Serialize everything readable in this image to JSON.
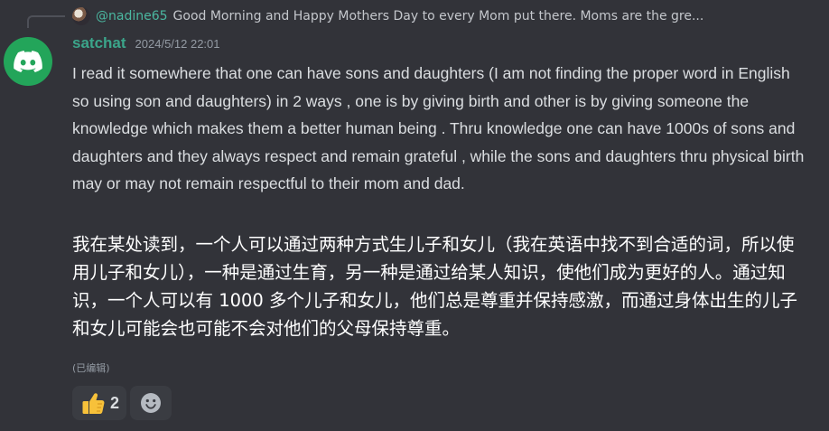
{
  "reply": {
    "author": "@nadine65",
    "text": "Good Morning and Happy Mothers Day to every Mom put there.  Moms are the gre..."
  },
  "message": {
    "author": "satchat",
    "timestamp": "2024/5/12 22:01",
    "content": "I read it somewhere that one can have sons and daughters (I am not finding the proper word in English so using son and daughters)  in 2 ways , one is by giving birth and other is by giving someone the knowledge which makes them a better human being . Thru knowledge one can have 1000s of sons and daughters and they always respect and remain grateful , while the sons and daughters thru physical birth  may or may not remain respectful to their mom and dad.",
    "translation": "我在某处读到，一个人可以通过两种方式生儿子和女儿（我在英语中找不到合适的词，所以使用儿子和女儿），一种是通过生育，另一种是通过给某人知识，使他们成为更好的人。通过知识，一个人可以有 1000 多个儿子和女儿，他们总是尊重并保持感激，而通过身体出生的儿子和女儿可能会也可能不会对他们的父母保持尊重。",
    "edited_label": "(已编辑)"
  },
  "reactions": [
    {
      "icon": "thumbs-up-icon",
      "count": "2"
    }
  ],
  "add_reaction": {
    "icon": "smiley-icon"
  },
  "colors": {
    "background": "#323339",
    "author": "#3ba58a",
    "reply_author": "#4bb7a0",
    "avatar_bg": "#23a55a",
    "reaction_bg": "#3a3c42"
  }
}
